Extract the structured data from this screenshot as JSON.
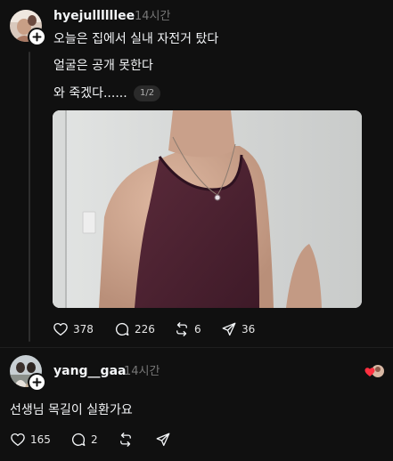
{
  "colors": {
    "background": "#101010",
    "text_primary": "#f3f5f7",
    "text_secondary": "#777777",
    "thread_line": "#2e2e2e",
    "pill_background": "#2a2a2a"
  },
  "icons": [
    "plus-icon",
    "heart-icon",
    "comment-icon",
    "repost-icon",
    "share-icon"
  ],
  "post": {
    "username": "hyejullllllee",
    "timestamp": "14시간",
    "lines": [
      "오늘은 집에서 실내 자전거 탔다",
      "얼굴은 공개 못한다",
      "와 죽겠다......"
    ],
    "page_indicator": "1/2",
    "photo_alt": "민소매 상의 사진",
    "actions": {
      "likes": "378",
      "comments": "226",
      "reposts": "6",
      "shares": "36"
    }
  },
  "reply": {
    "username": "yang__gaa",
    "timestamp": "14시간",
    "text": "선생님 목길이 실환가요",
    "actions": {
      "likes": "165",
      "comments": "2"
    }
  }
}
